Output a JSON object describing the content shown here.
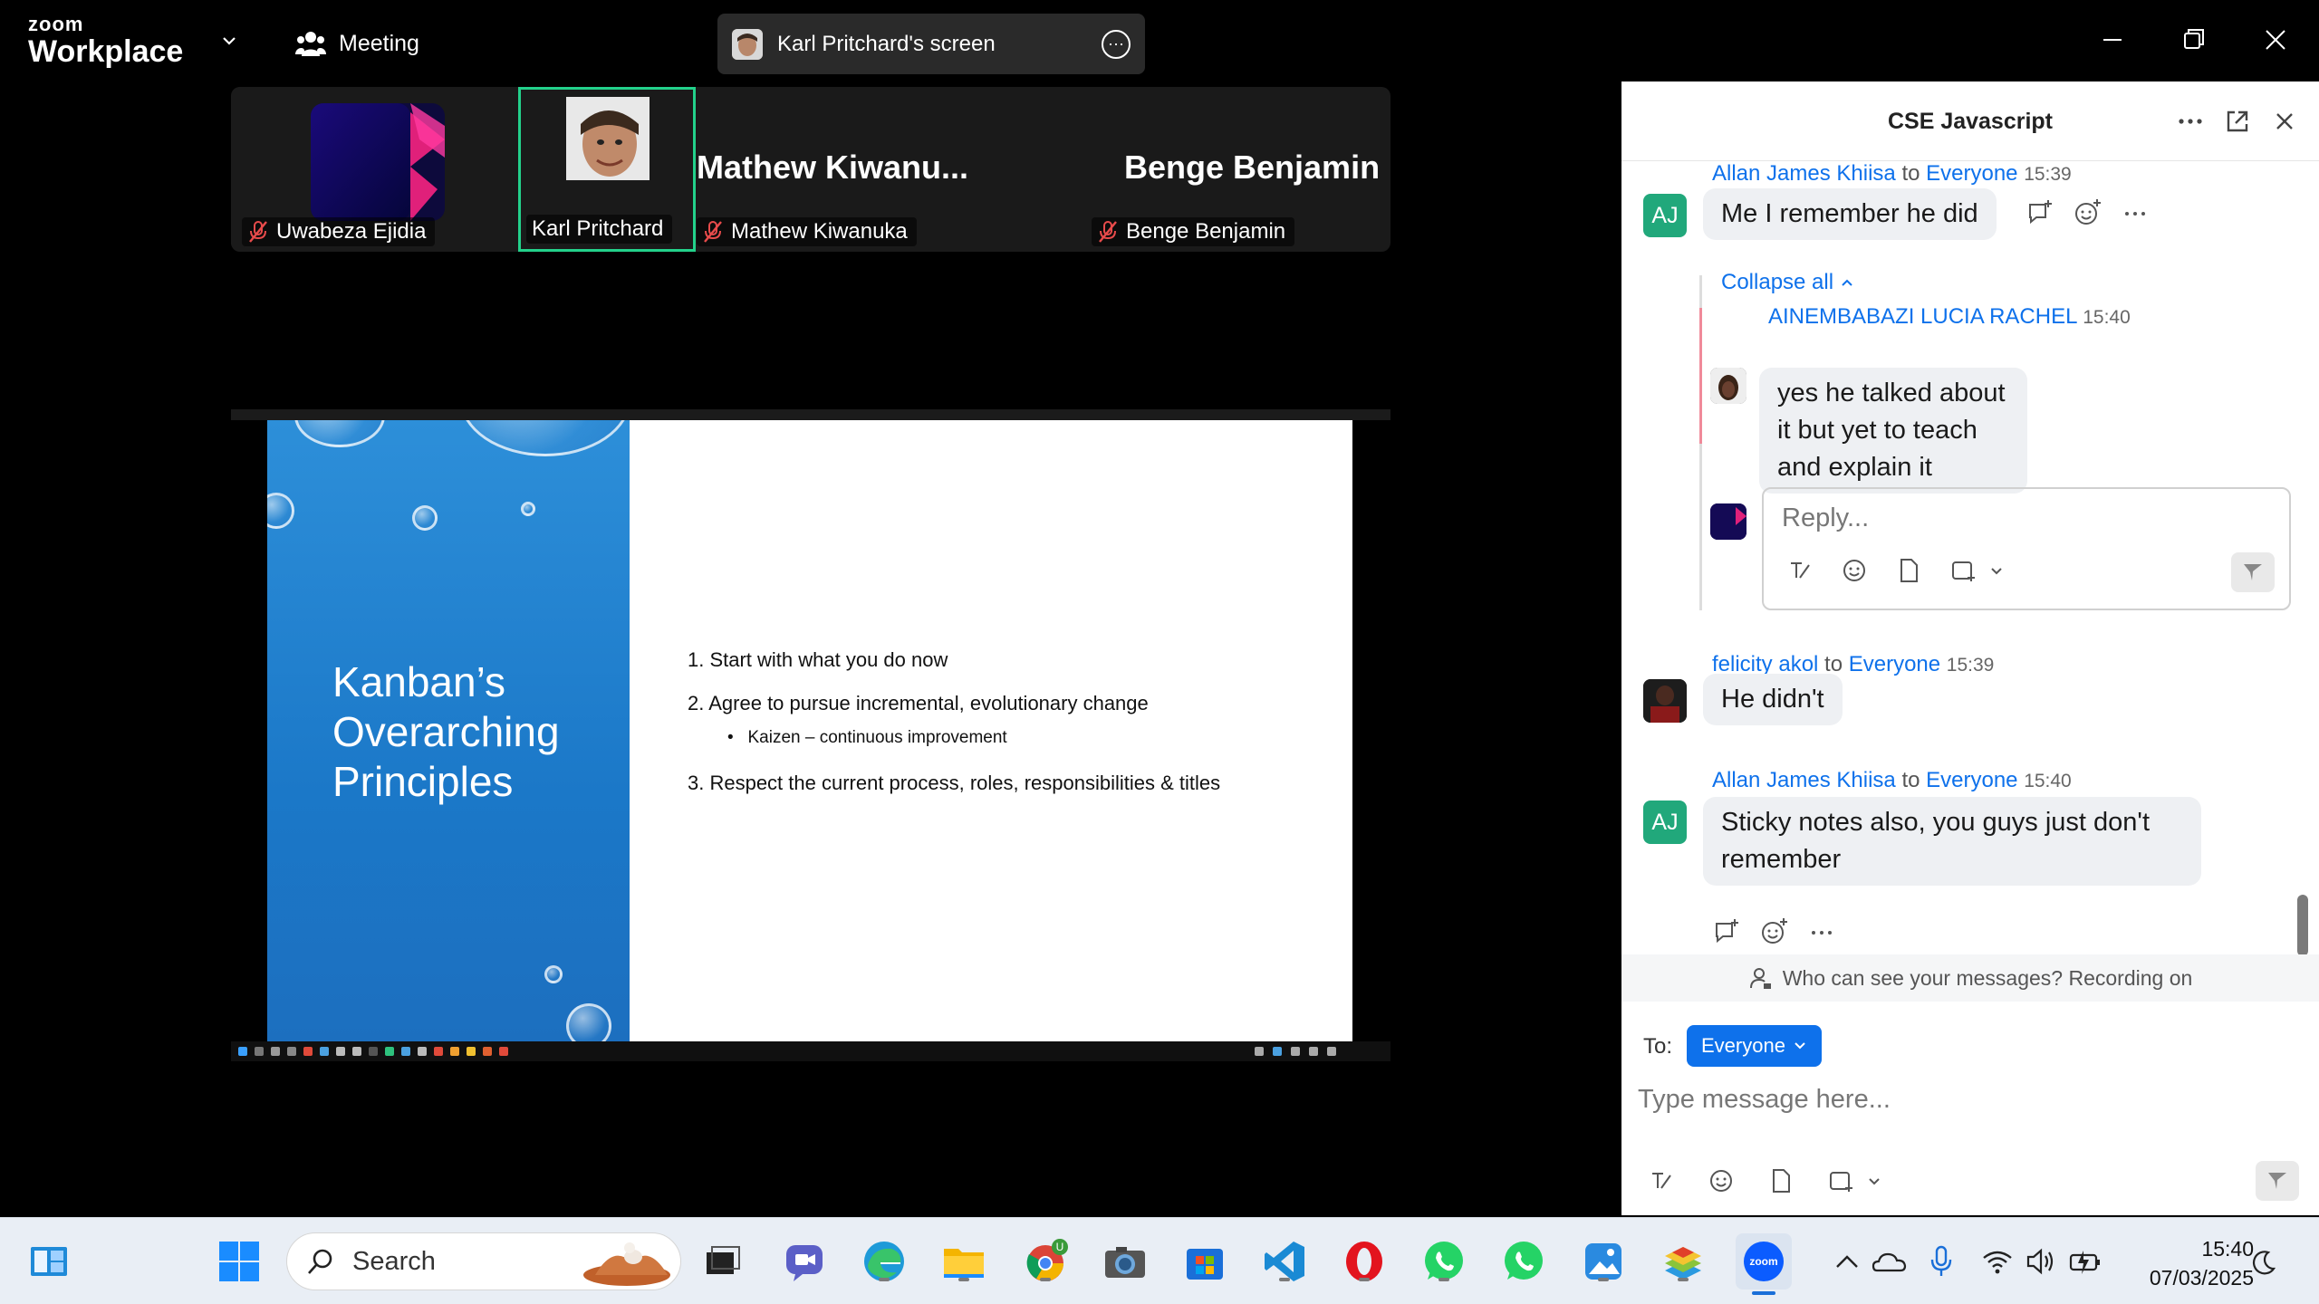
{
  "titlebar": {
    "logo_top": "zoom",
    "logo_bottom": "Workplace",
    "meeting_label": "Meeting",
    "share_label": "Karl Pritchard's screen"
  },
  "participants": [
    {
      "name": "Uwabeza Ejidia",
      "muted": true
    },
    {
      "name": "Karl Pritchard",
      "muted": false,
      "active_speaker": true
    },
    {
      "name": "Mathew Kiwanuka",
      "display_big": "Mathew  Kiwanu...",
      "muted": true
    },
    {
      "name": "Benge Benjamin",
      "display_big": "Benge Benjamin",
      "muted": true
    }
  ],
  "slide": {
    "title_lines": [
      "Kanban’s",
      "Overarching",
      "Principles"
    ],
    "items": [
      "1. Start with what you do now",
      "2. Agree to pursue incremental, evolutionary change",
      "Kaizen – continuous improvement",
      "3. Respect the current process, roles, responsibilities & titles"
    ]
  },
  "chat": {
    "title": "CSE Javascript",
    "to_word": "to",
    "collapse_label": "Collapse all",
    "reply_placeholder": "Reply...",
    "notice": "Who can see your messages? Recording on",
    "to_label": "To:",
    "to_value": "Everyone",
    "input_placeholder": "Type message here...",
    "messages": [
      {
        "sender": "Allan James Khiisa",
        "recipient": "Everyone",
        "time": "15:39",
        "text": "Me I remember he did",
        "avatar": "AJ"
      },
      {
        "sender": "AINEMBABAZI LUCIA RACHEL",
        "recipient": "",
        "time": "15:40",
        "text": "yes he talked about it but yet to teach and explain it"
      },
      {
        "sender": "felicity akol",
        "recipient": "Everyone",
        "time": "15:39",
        "text": "He didn't"
      },
      {
        "sender": "Allan James Khiisa",
        "recipient": "Everyone",
        "time": "15:40",
        "text": "Sticky notes also, you guys just don't remember",
        "avatar": "AJ"
      }
    ]
  },
  "taskbar": {
    "search_placeholder": "Search",
    "time": "15:40",
    "date": "07/03/2025",
    "zoom_badge": "zoom",
    "chrome_badge": "U"
  },
  "colors": {
    "accent": "#0e71eb",
    "speaker_border": "#23d18b",
    "avatar_green": "#21a87b",
    "slide_blue": "#1b78c8"
  }
}
